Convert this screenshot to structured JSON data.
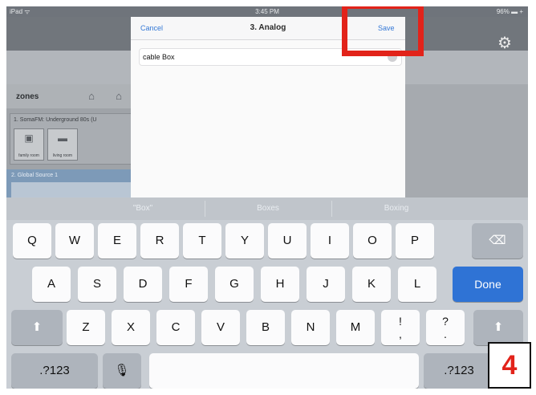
{
  "status_bar": {
    "carrier": "iPad ᯤ",
    "time": "3:45 PM",
    "battery": "96% ▬ +"
  },
  "icons": {
    "settings": "gear-icon",
    "home": "home-icon",
    "zone_edit": "house-icon"
  },
  "zones": {
    "label": "zones",
    "zone1": {
      "title": "1. SomaFM: Underground 80s (U",
      "tiles": [
        "family room",
        "living room"
      ]
    },
    "zone2": {
      "title": "2. Global Source 1",
      "sub": ""
    }
  },
  "modal": {
    "cancel": "Cancel",
    "title": "3. Analog",
    "save": "Save",
    "input_value": "cable Box"
  },
  "keyboard": {
    "suggestions": [
      "\"Box\"",
      "Boxes",
      "Boxing"
    ],
    "row1": [
      "Q",
      "W",
      "E",
      "R",
      "T",
      "Y",
      "U",
      "I",
      "O",
      "P",
      "⌫"
    ],
    "row2": [
      "A",
      "S",
      "D",
      "F",
      "G",
      "H",
      "J",
      "K",
      "L",
      "Done"
    ],
    "row3": [
      "⬆",
      "Z",
      "X",
      "C",
      "V",
      "B",
      "N",
      "M",
      "!",
      ",",
      "?",
      ".",
      "⬆"
    ],
    "row4": [
      ".?123",
      "🎙",
      "",
      ".?123"
    ]
  },
  "annotation_badge": "4",
  "colors": {
    "accent_blue": "#3478d6",
    "done_key": "#2f73d5",
    "highlight_red": "#e2231a"
  }
}
